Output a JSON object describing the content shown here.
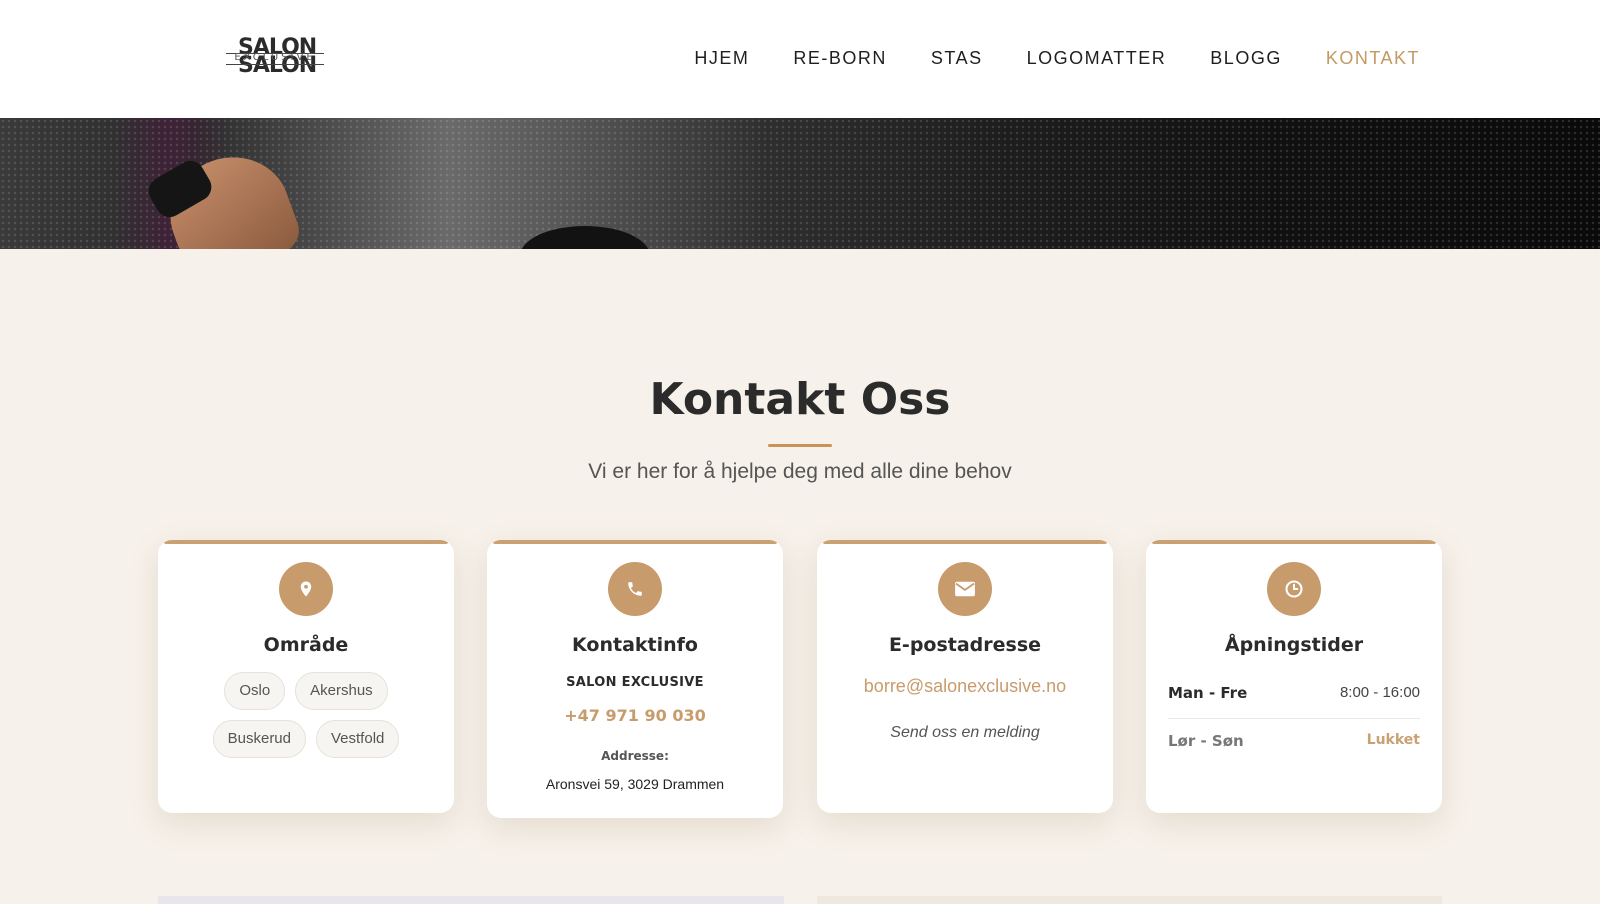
{
  "header": {
    "logo": {
      "top": "SALON",
      "middle": "EXCLUSIVE",
      "bottom": "SALON"
    },
    "nav": [
      {
        "label": "HJEM"
      },
      {
        "label": "RE-BORN"
      },
      {
        "label": "STAS"
      },
      {
        "label": "LOGOMATTER"
      },
      {
        "label": "BLOGG"
      },
      {
        "label": "KONTAKT",
        "active": true
      }
    ]
  },
  "section": {
    "title": "Kontakt Oss",
    "subtitle": "Vi er her for å hjelpe deg med alle dine behov"
  },
  "cards": {
    "area": {
      "icon": "map-pin-icon",
      "title": "Område",
      "chips": [
        "Oslo",
        "Akershus",
        "Buskerud",
        "Vestfold"
      ]
    },
    "contact": {
      "icon": "phone-icon",
      "title": "Kontaktinfo",
      "company": "SALON EXCLUSIVE",
      "phone": "+47 971 90 030",
      "address_label": "Addresse:",
      "address": "Aronsvei 59, 3029 Drammen"
    },
    "email": {
      "icon": "envelope-icon",
      "title": "E-postadresse",
      "address": "borre@salonexclusive.no",
      "note": "Send oss en melding"
    },
    "hours": {
      "icon": "clock-icon",
      "title": "Åpningstider",
      "rows": [
        {
          "day": "Man - Fre",
          "time": "8:00 - 16:00"
        },
        {
          "day": "Lør - Søn",
          "time": "Lukket"
        }
      ]
    }
  },
  "colors": {
    "accent": "#c89b6c",
    "background": "#f6f1ea",
    "text": "#2b2b2b"
  }
}
